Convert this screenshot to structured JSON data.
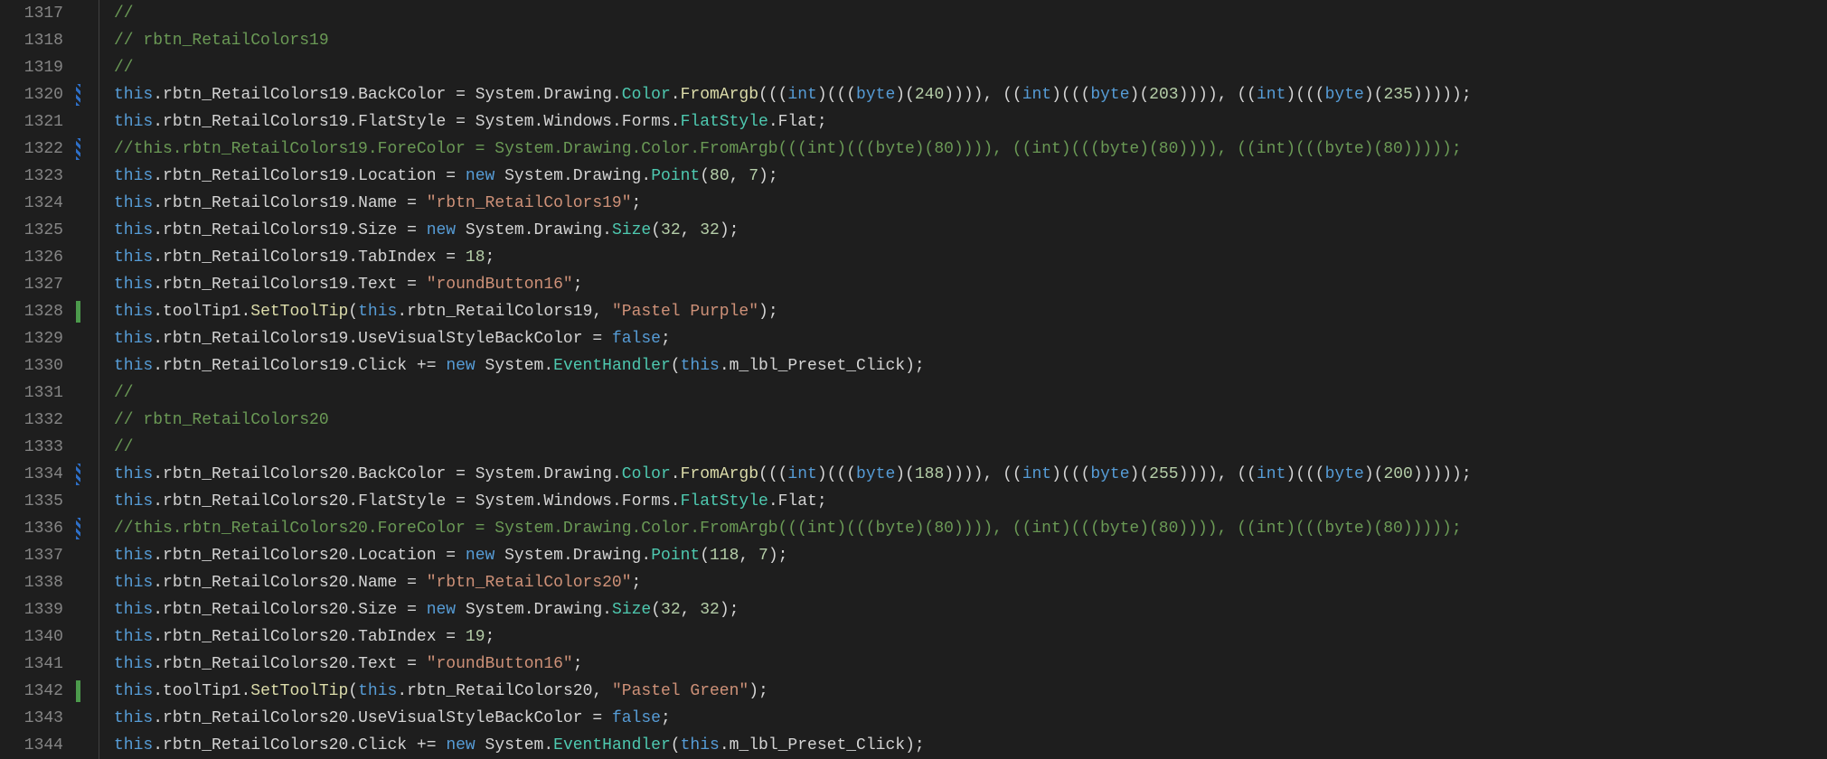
{
  "lineStart": 1317,
  "lines": [
    {
      "marker": "",
      "tokens": [
        [
          "comment",
          "// "
        ]
      ]
    },
    {
      "marker": "",
      "tokens": [
        [
          "comment",
          "// rbtn_RetailColors19"
        ]
      ]
    },
    {
      "marker": "",
      "tokens": [
        [
          "comment",
          "// "
        ]
      ]
    },
    {
      "marker": "blue",
      "tokens": [
        [
          "keyword",
          "this"
        ],
        [
          "punct",
          "."
        ],
        [
          "field",
          "rbtn_RetailColors19"
        ],
        [
          "punct",
          "."
        ],
        [
          "field",
          "BackColor"
        ],
        [
          "punct",
          " = "
        ],
        [
          "field",
          "System"
        ],
        [
          "punct",
          "."
        ],
        [
          "field",
          "Drawing"
        ],
        [
          "punct",
          "."
        ],
        [
          "class",
          "Color"
        ],
        [
          "punct",
          "."
        ],
        [
          "member",
          "FromArgb"
        ],
        [
          "punct",
          "((("
        ],
        [
          "keyword",
          "int"
        ],
        [
          "punct",
          ")((("
        ],
        [
          "keyword",
          "byte"
        ],
        [
          "punct",
          ")("
        ],
        [
          "number",
          "240"
        ],
        [
          "punct",
          ")))), (("
        ],
        [
          "keyword",
          "int"
        ],
        [
          "punct",
          ")((("
        ],
        [
          "keyword",
          "byte"
        ],
        [
          "punct",
          ")("
        ],
        [
          "number",
          "203"
        ],
        [
          "punct",
          ")))), (("
        ],
        [
          "keyword",
          "int"
        ],
        [
          "punct",
          ")((("
        ],
        [
          "keyword",
          "byte"
        ],
        [
          "punct",
          ")("
        ],
        [
          "number",
          "235"
        ],
        [
          "punct",
          ")))));"
        ]
      ]
    },
    {
      "marker": "",
      "tokens": [
        [
          "keyword",
          "this"
        ],
        [
          "punct",
          "."
        ],
        [
          "field",
          "rbtn_RetailColors19"
        ],
        [
          "punct",
          "."
        ],
        [
          "field",
          "FlatStyle"
        ],
        [
          "punct",
          " = "
        ],
        [
          "field",
          "System"
        ],
        [
          "punct",
          "."
        ],
        [
          "field",
          "Windows"
        ],
        [
          "punct",
          "."
        ],
        [
          "field",
          "Forms"
        ],
        [
          "punct",
          "."
        ],
        [
          "class",
          "FlatStyle"
        ],
        [
          "punct",
          "."
        ],
        [
          "field",
          "Flat"
        ],
        [
          "punct",
          ";"
        ]
      ]
    },
    {
      "marker": "blue",
      "tokens": [
        [
          "comment",
          "//this.rbtn_RetailColors19.ForeColor = System.Drawing.Color.FromArgb(((int)(((byte)(80)))), ((int)(((byte)(80)))), ((int)(((byte)(80)))));"
        ]
      ]
    },
    {
      "marker": "",
      "tokens": [
        [
          "keyword",
          "this"
        ],
        [
          "punct",
          "."
        ],
        [
          "field",
          "rbtn_RetailColors19"
        ],
        [
          "punct",
          "."
        ],
        [
          "field",
          "Location"
        ],
        [
          "punct",
          " = "
        ],
        [
          "keyword",
          "new"
        ],
        [
          "punct",
          " "
        ],
        [
          "field",
          "System"
        ],
        [
          "punct",
          "."
        ],
        [
          "field",
          "Drawing"
        ],
        [
          "punct",
          "."
        ],
        [
          "class",
          "Point"
        ],
        [
          "punct",
          "("
        ],
        [
          "number",
          "80"
        ],
        [
          "punct",
          ", "
        ],
        [
          "number",
          "7"
        ],
        [
          "punct",
          ");"
        ]
      ]
    },
    {
      "marker": "",
      "tokens": [
        [
          "keyword",
          "this"
        ],
        [
          "punct",
          "."
        ],
        [
          "field",
          "rbtn_RetailColors19"
        ],
        [
          "punct",
          "."
        ],
        [
          "field",
          "Name"
        ],
        [
          "punct",
          " = "
        ],
        [
          "string",
          "\"rbtn_RetailColors19\""
        ],
        [
          "punct",
          ";"
        ]
      ]
    },
    {
      "marker": "",
      "tokens": [
        [
          "keyword",
          "this"
        ],
        [
          "punct",
          "."
        ],
        [
          "field",
          "rbtn_RetailColors19"
        ],
        [
          "punct",
          "."
        ],
        [
          "field",
          "Size"
        ],
        [
          "punct",
          " = "
        ],
        [
          "keyword",
          "new"
        ],
        [
          "punct",
          " "
        ],
        [
          "field",
          "System"
        ],
        [
          "punct",
          "."
        ],
        [
          "field",
          "Drawing"
        ],
        [
          "punct",
          "."
        ],
        [
          "class",
          "Size"
        ],
        [
          "punct",
          "("
        ],
        [
          "number",
          "32"
        ],
        [
          "punct",
          ", "
        ],
        [
          "number",
          "32"
        ],
        [
          "punct",
          ");"
        ]
      ]
    },
    {
      "marker": "",
      "tokens": [
        [
          "keyword",
          "this"
        ],
        [
          "punct",
          "."
        ],
        [
          "field",
          "rbtn_RetailColors19"
        ],
        [
          "punct",
          "."
        ],
        [
          "field",
          "TabIndex"
        ],
        [
          "punct",
          " = "
        ],
        [
          "number",
          "18"
        ],
        [
          "punct",
          ";"
        ]
      ]
    },
    {
      "marker": "",
      "tokens": [
        [
          "keyword",
          "this"
        ],
        [
          "punct",
          "."
        ],
        [
          "field",
          "rbtn_RetailColors19"
        ],
        [
          "punct",
          "."
        ],
        [
          "field",
          "Text"
        ],
        [
          "punct",
          " = "
        ],
        [
          "string",
          "\"roundButton16\""
        ],
        [
          "punct",
          ";"
        ]
      ]
    },
    {
      "marker": "green",
      "tokens": [
        [
          "keyword",
          "this"
        ],
        [
          "punct",
          "."
        ],
        [
          "field",
          "toolTip1"
        ],
        [
          "punct",
          "."
        ],
        [
          "member",
          "SetToolTip"
        ],
        [
          "punct",
          "("
        ],
        [
          "keyword",
          "this"
        ],
        [
          "punct",
          "."
        ],
        [
          "field",
          "rbtn_RetailColors19"
        ],
        [
          "punct",
          ", "
        ],
        [
          "string",
          "\"Pastel Purple\""
        ],
        [
          "punct",
          ");"
        ]
      ]
    },
    {
      "marker": "",
      "tokens": [
        [
          "keyword",
          "this"
        ],
        [
          "punct",
          "."
        ],
        [
          "field",
          "rbtn_RetailColors19"
        ],
        [
          "punct",
          "."
        ],
        [
          "field",
          "UseVisualStyleBackColor"
        ],
        [
          "punct",
          " = "
        ],
        [
          "keyword",
          "false"
        ],
        [
          "punct",
          ";"
        ]
      ]
    },
    {
      "marker": "",
      "tokens": [
        [
          "keyword",
          "this"
        ],
        [
          "punct",
          "."
        ],
        [
          "field",
          "rbtn_RetailColors19"
        ],
        [
          "punct",
          "."
        ],
        [
          "field",
          "Click"
        ],
        [
          "punct",
          " += "
        ],
        [
          "keyword",
          "new"
        ],
        [
          "punct",
          " "
        ],
        [
          "field",
          "System"
        ],
        [
          "punct",
          "."
        ],
        [
          "class",
          "EventHandler"
        ],
        [
          "punct",
          "("
        ],
        [
          "keyword",
          "this"
        ],
        [
          "punct",
          "."
        ],
        [
          "field",
          "m_lbl_Preset_Click"
        ],
        [
          "punct",
          ");"
        ]
      ]
    },
    {
      "marker": "",
      "tokens": [
        [
          "comment",
          "// "
        ]
      ]
    },
    {
      "marker": "",
      "tokens": [
        [
          "comment",
          "// rbtn_RetailColors20"
        ]
      ]
    },
    {
      "marker": "",
      "tokens": [
        [
          "comment",
          "// "
        ]
      ]
    },
    {
      "marker": "blue",
      "tokens": [
        [
          "keyword",
          "this"
        ],
        [
          "punct",
          "."
        ],
        [
          "field",
          "rbtn_RetailColors20"
        ],
        [
          "punct",
          "."
        ],
        [
          "field",
          "BackColor"
        ],
        [
          "punct",
          " = "
        ],
        [
          "field",
          "System"
        ],
        [
          "punct",
          "."
        ],
        [
          "field",
          "Drawing"
        ],
        [
          "punct",
          "."
        ],
        [
          "class",
          "Color"
        ],
        [
          "punct",
          "."
        ],
        [
          "member",
          "FromArgb"
        ],
        [
          "punct",
          "((("
        ],
        [
          "keyword",
          "int"
        ],
        [
          "punct",
          ")((("
        ],
        [
          "keyword",
          "byte"
        ],
        [
          "punct",
          ")("
        ],
        [
          "number",
          "188"
        ],
        [
          "punct",
          ")))), (("
        ],
        [
          "keyword",
          "int"
        ],
        [
          "punct",
          ")((("
        ],
        [
          "keyword",
          "byte"
        ],
        [
          "punct",
          ")("
        ],
        [
          "number",
          "255"
        ],
        [
          "punct",
          ")))), (("
        ],
        [
          "keyword",
          "int"
        ],
        [
          "punct",
          ")((("
        ],
        [
          "keyword",
          "byte"
        ],
        [
          "punct",
          ")("
        ],
        [
          "number",
          "200"
        ],
        [
          "punct",
          ")))));"
        ]
      ]
    },
    {
      "marker": "",
      "tokens": [
        [
          "keyword",
          "this"
        ],
        [
          "punct",
          "."
        ],
        [
          "field",
          "rbtn_RetailColors20"
        ],
        [
          "punct",
          "."
        ],
        [
          "field",
          "FlatStyle"
        ],
        [
          "punct",
          " = "
        ],
        [
          "field",
          "System"
        ],
        [
          "punct",
          "."
        ],
        [
          "field",
          "Windows"
        ],
        [
          "punct",
          "."
        ],
        [
          "field",
          "Forms"
        ],
        [
          "punct",
          "."
        ],
        [
          "class",
          "FlatStyle"
        ],
        [
          "punct",
          "."
        ],
        [
          "field",
          "Flat"
        ],
        [
          "punct",
          ";"
        ]
      ]
    },
    {
      "marker": "blue",
      "tokens": [
        [
          "comment",
          "//this.rbtn_RetailColors20.ForeColor = System.Drawing.Color.FromArgb(((int)(((byte)(80)))), ((int)(((byte)(80)))), ((int)(((byte)(80)))));"
        ]
      ]
    },
    {
      "marker": "",
      "tokens": [
        [
          "keyword",
          "this"
        ],
        [
          "punct",
          "."
        ],
        [
          "field",
          "rbtn_RetailColors20"
        ],
        [
          "punct",
          "."
        ],
        [
          "field",
          "Location"
        ],
        [
          "punct",
          " = "
        ],
        [
          "keyword",
          "new"
        ],
        [
          "punct",
          " "
        ],
        [
          "field",
          "System"
        ],
        [
          "punct",
          "."
        ],
        [
          "field",
          "Drawing"
        ],
        [
          "punct",
          "."
        ],
        [
          "class",
          "Point"
        ],
        [
          "punct",
          "("
        ],
        [
          "number",
          "118"
        ],
        [
          "punct",
          ", "
        ],
        [
          "number",
          "7"
        ],
        [
          "punct",
          ");"
        ]
      ]
    },
    {
      "marker": "",
      "tokens": [
        [
          "keyword",
          "this"
        ],
        [
          "punct",
          "."
        ],
        [
          "field",
          "rbtn_RetailColors20"
        ],
        [
          "punct",
          "."
        ],
        [
          "field",
          "Name"
        ],
        [
          "punct",
          " = "
        ],
        [
          "string",
          "\"rbtn_RetailColors20\""
        ],
        [
          "punct",
          ";"
        ]
      ]
    },
    {
      "marker": "",
      "tokens": [
        [
          "keyword",
          "this"
        ],
        [
          "punct",
          "."
        ],
        [
          "field",
          "rbtn_RetailColors20"
        ],
        [
          "punct",
          "."
        ],
        [
          "field",
          "Size"
        ],
        [
          "punct",
          " = "
        ],
        [
          "keyword",
          "new"
        ],
        [
          "punct",
          " "
        ],
        [
          "field",
          "System"
        ],
        [
          "punct",
          "."
        ],
        [
          "field",
          "Drawing"
        ],
        [
          "punct",
          "."
        ],
        [
          "class",
          "Size"
        ],
        [
          "punct",
          "("
        ],
        [
          "number",
          "32"
        ],
        [
          "punct",
          ", "
        ],
        [
          "number",
          "32"
        ],
        [
          "punct",
          ");"
        ]
      ]
    },
    {
      "marker": "",
      "tokens": [
        [
          "keyword",
          "this"
        ],
        [
          "punct",
          "."
        ],
        [
          "field",
          "rbtn_RetailColors20"
        ],
        [
          "punct",
          "."
        ],
        [
          "field",
          "TabIndex"
        ],
        [
          "punct",
          " = "
        ],
        [
          "number",
          "19"
        ],
        [
          "punct",
          ";"
        ]
      ]
    },
    {
      "marker": "",
      "tokens": [
        [
          "keyword",
          "this"
        ],
        [
          "punct",
          "."
        ],
        [
          "field",
          "rbtn_RetailColors20"
        ],
        [
          "punct",
          "."
        ],
        [
          "field",
          "Text"
        ],
        [
          "punct",
          " = "
        ],
        [
          "string",
          "\"roundButton16\""
        ],
        [
          "punct",
          ";"
        ]
      ]
    },
    {
      "marker": "green",
      "tokens": [
        [
          "keyword",
          "this"
        ],
        [
          "punct",
          "."
        ],
        [
          "field",
          "toolTip1"
        ],
        [
          "punct",
          "."
        ],
        [
          "member",
          "SetToolTip"
        ],
        [
          "punct",
          "("
        ],
        [
          "keyword",
          "this"
        ],
        [
          "punct",
          "."
        ],
        [
          "field",
          "rbtn_RetailColors20"
        ],
        [
          "punct",
          ", "
        ],
        [
          "string",
          "\"Pastel Green\""
        ],
        [
          "punct",
          ");"
        ]
      ]
    },
    {
      "marker": "",
      "tokens": [
        [
          "keyword",
          "this"
        ],
        [
          "punct",
          "."
        ],
        [
          "field",
          "rbtn_RetailColors20"
        ],
        [
          "punct",
          "."
        ],
        [
          "field",
          "UseVisualStyleBackColor"
        ],
        [
          "punct",
          " = "
        ],
        [
          "keyword",
          "false"
        ],
        [
          "punct",
          ";"
        ]
      ]
    },
    {
      "marker": "",
      "tokens": [
        [
          "keyword",
          "this"
        ],
        [
          "punct",
          "."
        ],
        [
          "field",
          "rbtn_RetailColors20"
        ],
        [
          "punct",
          "."
        ],
        [
          "field",
          "Click"
        ],
        [
          "punct",
          " += "
        ],
        [
          "keyword",
          "new"
        ],
        [
          "punct",
          " "
        ],
        [
          "field",
          "System"
        ],
        [
          "punct",
          "."
        ],
        [
          "class",
          "EventHandler"
        ],
        [
          "punct",
          "("
        ],
        [
          "keyword",
          "this"
        ],
        [
          "punct",
          "."
        ],
        [
          "field",
          "m_lbl_Preset_Click"
        ],
        [
          "punct",
          ");"
        ]
      ]
    }
  ]
}
